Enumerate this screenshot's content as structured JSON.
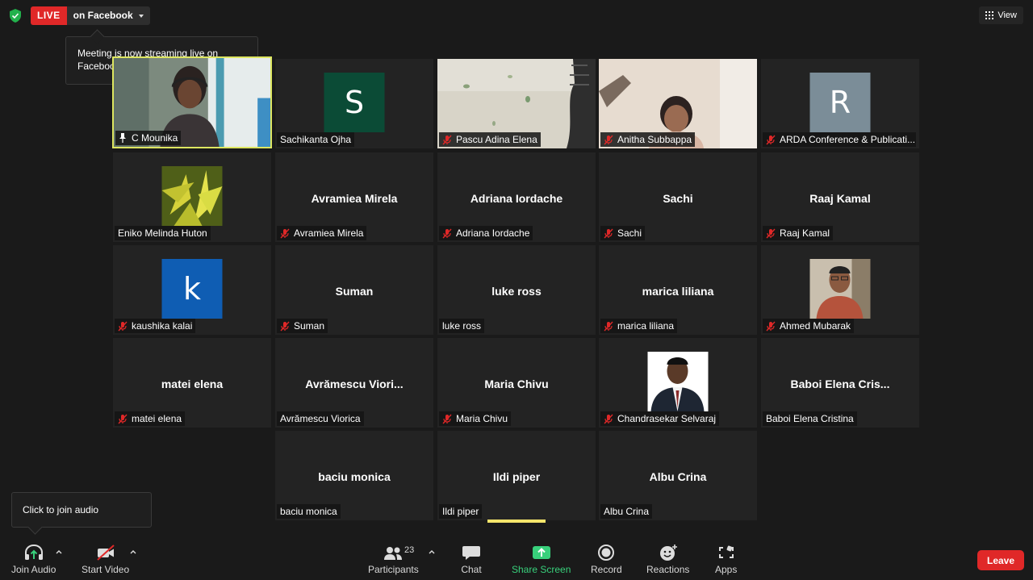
{
  "live": {
    "badge": "LIVE",
    "platform": "on Facebook",
    "tooltip": "Meeting is now streaming live on Facebook"
  },
  "view_button": {
    "label": "View"
  },
  "tiles": [
    {
      "center_name": "",
      "label": "C Mounika",
      "label_icon": "pin-icon",
      "video": "camera-woman-headset"
    },
    {
      "center_name": "",
      "label": "Sachikanta Ojha",
      "label_icon": "",
      "avatar_letter": "S",
      "avatar_color": "#0b4b36"
    },
    {
      "center_name": "",
      "label": "Pascu Adina Elena",
      "label_icon": "mic-muted-icon",
      "video": "camera-room-chair"
    },
    {
      "center_name": "",
      "label": "Anitha Subbappa",
      "label_icon": "mic-muted-icon",
      "video": "camera-woman"
    },
    {
      "center_name": "",
      "label": "ARDA Conference & Publicati...",
      "label_icon": "mic-muted-icon",
      "avatar_letter": "R",
      "avatar_color": "#7b8d98"
    },
    {
      "center_name": "",
      "label": "Eniko Melinda Huton",
      "label_icon": "",
      "video": "profile-plant"
    },
    {
      "center_name": "Avramiea Mirela",
      "label": "Avramiea Mirela",
      "label_icon": "mic-muted-icon"
    },
    {
      "center_name": "Adriana Iordache",
      "label": "Adriana Iordache",
      "label_icon": "mic-muted-icon"
    },
    {
      "center_name": "Sachi",
      "label": "Sachi",
      "label_icon": "mic-muted-icon"
    },
    {
      "center_name": "Raaj Kamal",
      "label": "Raaj Kamal",
      "label_icon": "mic-muted-icon"
    },
    {
      "center_name": "",
      "label": "kaushika kalai",
      "label_icon": "mic-muted-icon",
      "avatar_letter": "k",
      "avatar_color": "#0f5db3"
    },
    {
      "center_name": "Suman",
      "label": "Suman",
      "label_icon": "mic-muted-icon"
    },
    {
      "center_name": "luke ross",
      "label": "luke ross",
      "label_icon": ""
    },
    {
      "center_name": "marica liliana",
      "label": "marica liliana",
      "label_icon": "mic-muted-icon"
    },
    {
      "center_name": "",
      "label": "Ahmed Mubarak",
      "label_icon": "mic-muted-icon",
      "video": "profile-man"
    },
    {
      "center_name": "matei elena",
      "label": "matei elena",
      "label_icon": "mic-muted-icon"
    },
    {
      "center_name": "Avrămescu  Viori...",
      "label": "Avrămescu Viorica",
      "label_icon": ""
    },
    {
      "center_name": "Maria Chivu",
      "label": "Maria Chivu",
      "label_icon": "mic-muted-icon"
    },
    {
      "center_name": "",
      "label": "Chandrasekar Selvaraj",
      "label_icon": "mic-muted-icon",
      "video": "profile-man-suit"
    },
    {
      "center_name": "Baboi Elena  Cris...",
      "label": "Baboi Elena Cristina",
      "label_icon": ""
    },
    {
      "center_name": "baciu monica",
      "label": "baciu monica",
      "label_icon": ""
    },
    {
      "center_name": "Ildi piper",
      "label": "Ildi piper",
      "label_icon": ""
    },
    {
      "center_name": "Albu Crina",
      "label": "Albu Crina",
      "label_icon": ""
    }
  ],
  "audio_tooltip": "Click to join audio",
  "toolbar": {
    "join_audio": "Join Audio",
    "start_video": "Start Video",
    "participants": "Participants",
    "participants_count": "23",
    "chat": "Chat",
    "share_screen": "Share Screen",
    "record": "Record",
    "reactions": "Reactions",
    "apps": "Apps",
    "leave": "Leave"
  },
  "colors": {
    "live_red": "#e02828",
    "active_speaker": "#dde660",
    "share_green": "#38d07b",
    "background": "#1a1a1a",
    "tile": "#232323"
  }
}
